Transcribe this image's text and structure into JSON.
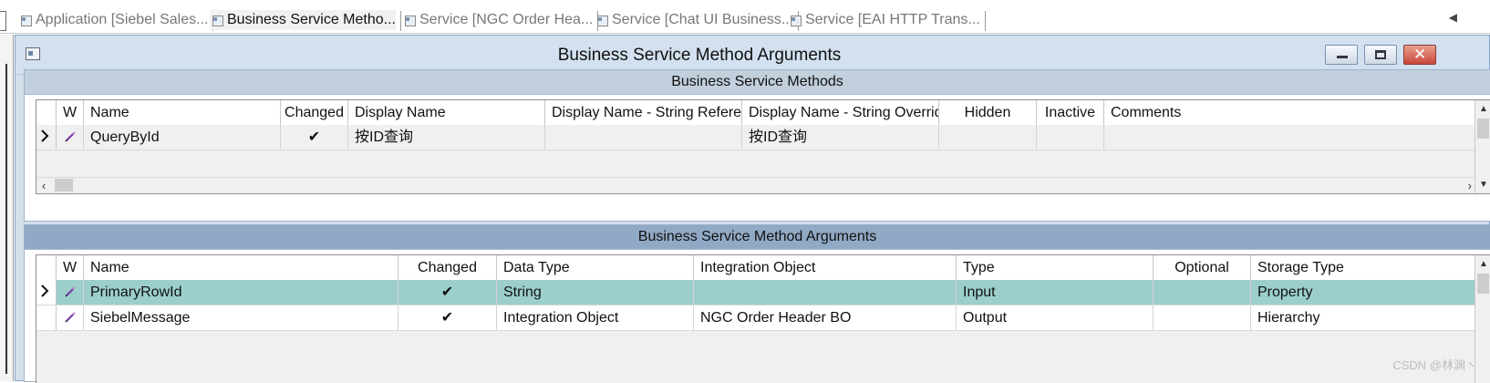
{
  "tabs": [
    {
      "label": "Application [Siebel Sales...",
      "active": false
    },
    {
      "label": "Business Service Metho...",
      "active": true
    },
    {
      "label": "Service [NGC Order Hea...",
      "active": false
    },
    {
      "label": "Service [Chat UI Business...",
      "active": false
    },
    {
      "label": "Service [EAI HTTP Trans...",
      "active": false
    }
  ],
  "window": {
    "title": "Business Service Method Arguments"
  },
  "methods": {
    "header": "Business Service Methods",
    "columns": [
      "W",
      "Name",
      "Changed",
      "Display Name",
      "Display Name - String Refere",
      "Display Name - String Overrid",
      "Hidden",
      "Inactive",
      "Comments"
    ],
    "rows": [
      {
        "name": "QueryById",
        "changed": "✔",
        "display_name": "按ID查询",
        "dn_string_ref": "",
        "dn_string_override": "按ID查询",
        "hidden": "",
        "inactive": "",
        "comments": ""
      }
    ]
  },
  "arguments": {
    "header": "Business Service Method Arguments",
    "columns": [
      "W",
      "Name",
      "Changed",
      "Data Type",
      "Integration Object",
      "Type",
      "Optional",
      "Storage Type"
    ],
    "rows": [
      {
        "name": "PrimaryRowId",
        "changed": "✔",
        "data_type": "String",
        "integration_object": "",
        "type": "Input",
        "optional": "",
        "storage_type": "Property",
        "selected": true
      },
      {
        "name": "SiebelMessage",
        "changed": "✔",
        "data_type": "Integration Object",
        "integration_object": "NGC Order Header BO",
        "type": "Output",
        "optional": "",
        "storage_type": "Hierarchy",
        "selected": false
      }
    ]
  },
  "watermark": "CSDN @林渊丶",
  "colors": {
    "selected_row": "#9ccfcb",
    "title_bar": "#d3e0ef",
    "section_header_active": "#90a9c5",
    "close_button": "#c8473a"
  }
}
